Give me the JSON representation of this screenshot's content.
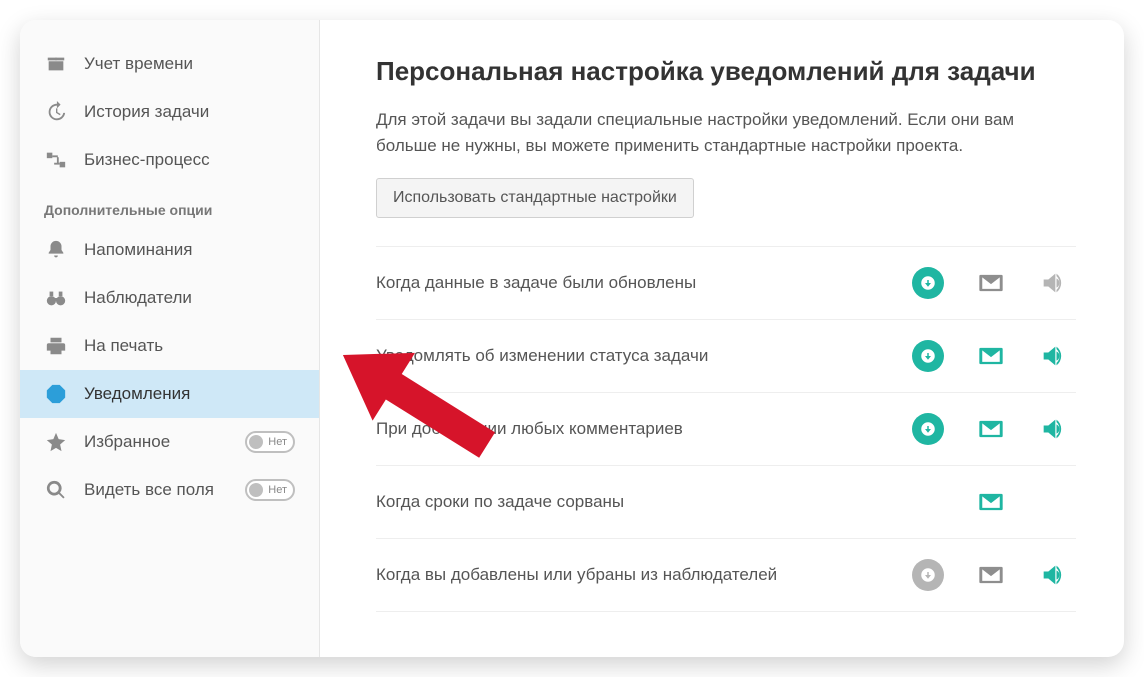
{
  "sidebar": {
    "primary": [
      {
        "id": "timetracking",
        "label": "Учет времени"
      },
      {
        "id": "history",
        "label": "История задачи"
      },
      {
        "id": "process",
        "label": "Бизнес-процесс"
      }
    ],
    "sectionTitle": "Дополнительные опции",
    "extra": [
      {
        "id": "reminders",
        "label": "Напоминания"
      },
      {
        "id": "watchers",
        "label": "Наблюдатели"
      },
      {
        "id": "print",
        "label": "На печать"
      },
      {
        "id": "notifications",
        "label": "Уведомления",
        "active": true
      },
      {
        "id": "favorites",
        "label": "Избранное",
        "toggle": "Нет"
      },
      {
        "id": "allfields",
        "label": "Видеть все поля",
        "toggle": "Нет"
      }
    ]
  },
  "main": {
    "title": "Персональная настройка уведомлений для задачи",
    "description": "Для этой задачи вы задали специальные настройки уведомлений. Если они вам больше не нужны, вы можете применить стандартные настройки проекта.",
    "stdButton": "Использовать стандартные настройки",
    "rows": [
      {
        "label": "Когда данные в задаче были обновлены",
        "push": true,
        "mail": false,
        "sound": false,
        "showPush": true
      },
      {
        "label": "Уведомлять об изменении статуса задачи",
        "push": true,
        "mail": true,
        "sound": true,
        "showPush": true
      },
      {
        "label": "При добавлении любых комментариев",
        "push": true,
        "mail": true,
        "sound": true,
        "showPush": true
      },
      {
        "label": "Когда сроки по задаче сорваны",
        "push": false,
        "mail": true,
        "sound": false,
        "showPush": false,
        "showSound": false
      },
      {
        "label": "Когда вы добавлены или убраны из наблюдателей",
        "push": false,
        "mail": false,
        "sound": true,
        "showPush": true
      }
    ]
  },
  "colors": {
    "accent": "#1fb6a2",
    "activeBg": "#cfe8f7",
    "arrow": "#d6142a"
  }
}
